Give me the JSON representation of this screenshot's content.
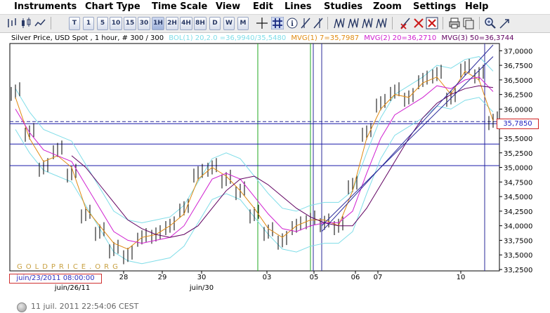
{
  "menu": [
    "Instruments",
    "Chart Type",
    "Time Scale",
    "View",
    "Edit",
    "Lines",
    "Studies",
    "Zoom",
    "Settings",
    "Help"
  ],
  "toolbar": {
    "timeframes": [
      "T",
      "1",
      "5",
      "10",
      "15",
      "30",
      "1H",
      "2H",
      "4H",
      "8H",
      "D",
      "W",
      "M"
    ],
    "selected_timeframe": "1H"
  },
  "chart": {
    "title": "Silver Price, USD Spot , 1 hour, # 300 / 300",
    "studies": [
      {
        "label": "BOL(1) 20,2.0 =36,9940/35,5480",
        "color": "#7fdde8"
      },
      {
        "label": "MVG(1) 7=35,7987",
        "color": "#e08a10"
      },
      {
        "label": "MVG(2) 20=36,2710",
        "color": "#d020d0"
      },
      {
        "label": "MVG(3) 50=36,3744",
        "color": "#600060"
      }
    ],
    "current_price": "35,7850",
    "watermark": "GOLDPRICE.ORG",
    "cursor_date": "juin/23/2011 08:00:00"
  },
  "chart_data": {
    "type": "line",
    "title": "Silver Price, USD Spot , 1 hour, # 300 / 300",
    "ylim": [
      33.25,
      37.1
    ],
    "y_ticks": [
      "37,0000",
      "36,7500",
      "36,5000",
      "36,2500",
      "36,0000",
      "35,7500",
      "35,5000",
      "35,2500",
      "35,0000",
      "34,7500",
      "34,5000",
      "34,2500",
      "34,0000",
      "33,7500",
      "33,5000",
      "33,2500"
    ],
    "x_ticks_top": [
      "28",
      "29",
      "30",
      "03",
      "05",
      "06",
      "07",
      "10"
    ],
    "x_ticks_bottom": [
      "juin/26/11",
      "juin/30"
    ],
    "series": [
      {
        "name": "Silver Price",
        "values": [
          36.3,
          35.6,
          35.0,
          35.3,
          34.9,
          34.2,
          33.9,
          33.6,
          33.5,
          33.8,
          33.85,
          34.0,
          34.3,
          34.9,
          35.0,
          34.8,
          34.6,
          34.2,
          33.9,
          33.75,
          34.0,
          34.1,
          34.05,
          34.0,
          34.7,
          35.6,
          36.1,
          36.3,
          36.2,
          36.5,
          36.6,
          36.2,
          36.7,
          36.6,
          35.8
        ]
      },
      {
        "name": "MVG(1) 7",
        "values": [
          36.2,
          35.5,
          35.1,
          35.2,
          35.0,
          34.3,
          34.0,
          33.7,
          33.6,
          33.8,
          33.85,
          34.0,
          34.2,
          34.8,
          35.0,
          34.85,
          34.6,
          34.3,
          33.95,
          33.8,
          34.0,
          34.1,
          34.1,
          34.0,
          34.6,
          35.5,
          36.0,
          36.25,
          36.2,
          36.45,
          36.55,
          36.25,
          36.65,
          36.5,
          35.8
        ]
      },
      {
        "name": "MVG(2) 20",
        "values": [
          36.0,
          35.6,
          35.3,
          35.2,
          35.1,
          34.7,
          34.3,
          33.9,
          33.75,
          33.7,
          33.75,
          33.8,
          34.0,
          34.4,
          34.8,
          34.9,
          34.8,
          34.5,
          34.2,
          33.95,
          33.9,
          34.0,
          34.05,
          34.05,
          34.25,
          34.9,
          35.5,
          35.9,
          36.05,
          36.2,
          36.4,
          36.35,
          36.5,
          36.55,
          36.3
        ]
      },
      {
        "name": "MVG(3) 50",
        "values": [
          null,
          null,
          null,
          null,
          35.2,
          35.0,
          34.7,
          34.4,
          34.1,
          33.95,
          33.85,
          33.8,
          33.85,
          34.0,
          34.3,
          34.6,
          34.8,
          34.85,
          34.7,
          34.5,
          34.3,
          34.15,
          34.05,
          34.0,
          34.0,
          34.3,
          34.7,
          35.1,
          35.5,
          35.85,
          36.1,
          36.25,
          36.35,
          36.4,
          36.37
        ]
      }
    ],
    "horizontal_lines": [
      35.785,
      35.75,
      35.4,
      35.03
    ],
    "current_price": 35.785
  },
  "status": {
    "text": "11 juil. 2011 22:54:06 CEST"
  }
}
